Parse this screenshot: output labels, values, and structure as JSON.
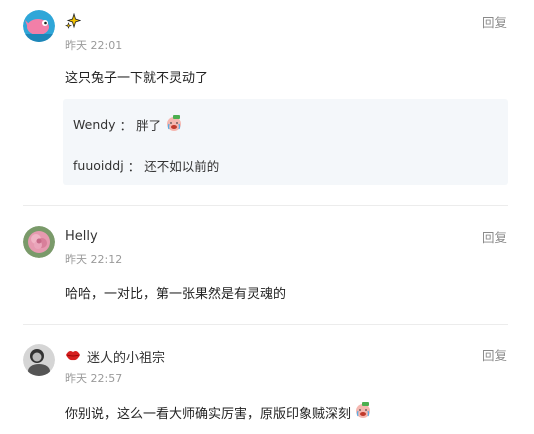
{
  "comments": [
    {
      "username": "",
      "username_icon": "sparkle-icon",
      "time": "昨天 22:01",
      "reply_label": "回复",
      "text": "这只兔子一下就不灵动了",
      "replies": [
        {
          "author": "Wendy",
          "sep": "：",
          "text": "胖了",
          "emoji": "crying-face-emoji"
        },
        {
          "author": "fuuoiddj",
          "sep": "：",
          "text": "还不如以前的"
        }
      ],
      "avatar": "pink-bird-avatar"
    },
    {
      "username": "Helly",
      "time": "昨天 22:12",
      "reply_label": "回复",
      "text": "哈哈，一对比，第一张果然是有灵魂的",
      "avatar": "flower-avatar"
    },
    {
      "username": "迷人的小祖宗",
      "username_icon": "lips-icon",
      "time": "昨天 22:57",
      "reply_label": "回复",
      "text": "你别说，这么一看大师确实厉害，原版印象贼深刻",
      "text_emoji": "crying-face-emoji",
      "avatar": "bw-photo-avatar"
    }
  ],
  "colors": {
    "time": "#9a9a9a",
    "reply": "#8a8a8a",
    "quote_bg": "#f4f7fa",
    "divider": "#ececec"
  }
}
